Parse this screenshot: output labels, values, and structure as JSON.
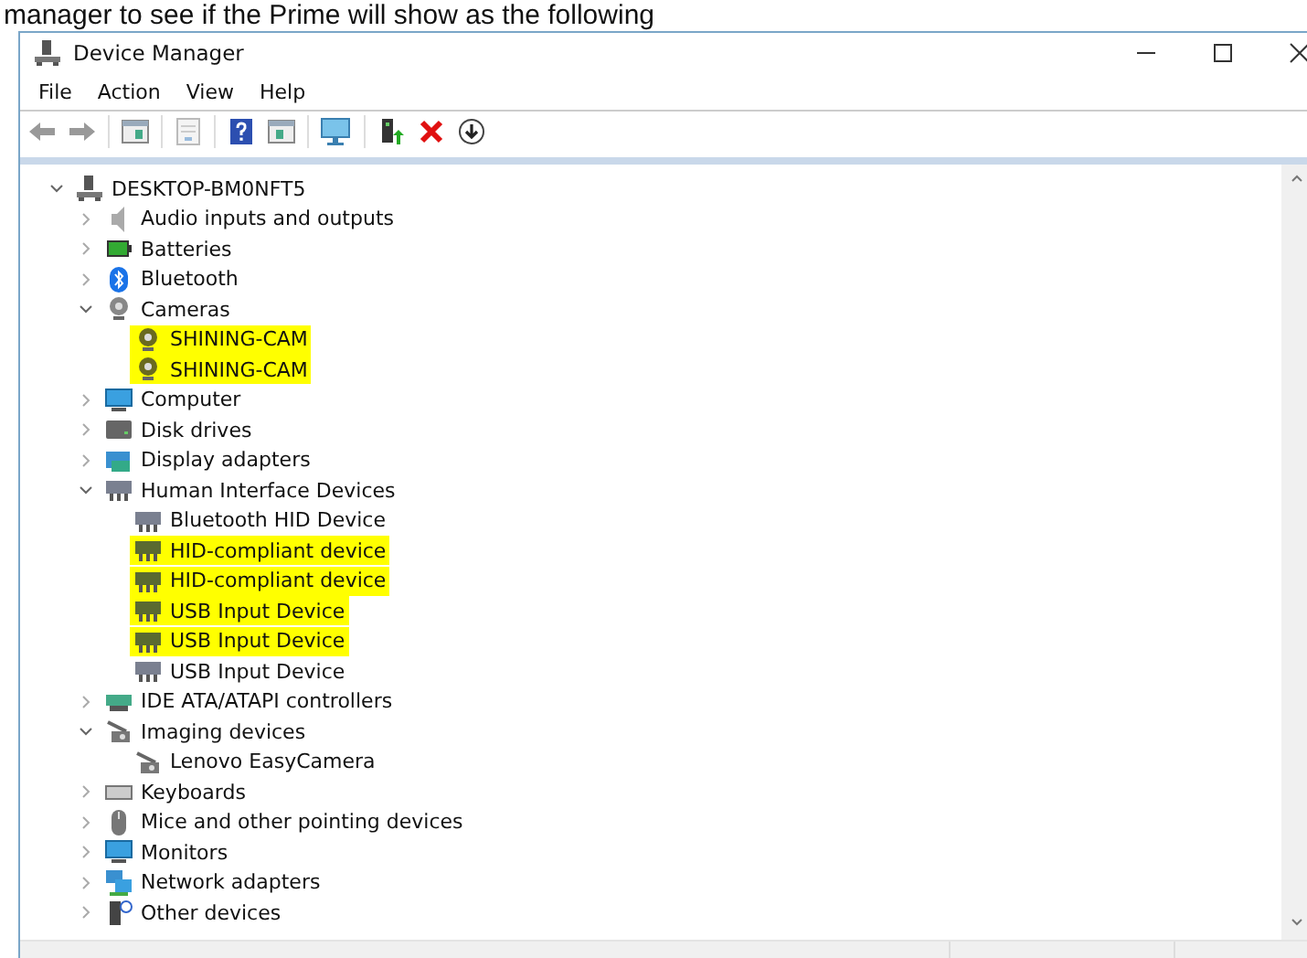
{
  "caption": "manager to see if the Prime will show as the following",
  "window": {
    "title": "Device Manager"
  },
  "menu": [
    "File",
    "Action",
    "View",
    "Help"
  ],
  "tree": {
    "label": "DESKTOP-BM0NFT5",
    "expanded": true,
    "children": [
      {
        "label": "Audio inputs and outputs",
        "expanded": false
      },
      {
        "label": "Batteries",
        "expanded": false
      },
      {
        "label": "Bluetooth",
        "expanded": false
      },
      {
        "label": "Cameras",
        "expanded": true,
        "children": [
          {
            "label": "SHINING-CAM",
            "highlighted": true
          },
          {
            "label": "SHINING-CAM",
            "highlighted": true
          }
        ]
      },
      {
        "label": "Computer",
        "expanded": false
      },
      {
        "label": "Disk drives",
        "expanded": false
      },
      {
        "label": "Display adapters",
        "expanded": false
      },
      {
        "label": "Human Interface Devices",
        "expanded": true,
        "children": [
          {
            "label": "Bluetooth HID Device",
            "highlighted": false
          },
          {
            "label": "HID-compliant device",
            "highlighted": true
          },
          {
            "label": "HID-compliant device",
            "highlighted": true
          },
          {
            "label": "USB Input Device",
            "highlighted": true
          },
          {
            "label": "USB Input Device",
            "highlighted": true
          },
          {
            "label": "USB Input Device",
            "highlighted": false
          }
        ]
      },
      {
        "label": "IDE ATA/ATAPI controllers",
        "expanded": false
      },
      {
        "label": "Imaging devices",
        "expanded": true,
        "children": [
          {
            "label": "Lenovo EasyCamera",
            "highlighted": false
          }
        ]
      },
      {
        "label": "Keyboards",
        "expanded": false
      },
      {
        "label": "Mice and other pointing devices",
        "expanded": false
      },
      {
        "label": "Monitors",
        "expanded": false
      },
      {
        "label": "Network adapters",
        "expanded": false
      },
      {
        "label": "Other devices",
        "expanded": false
      }
    ]
  }
}
